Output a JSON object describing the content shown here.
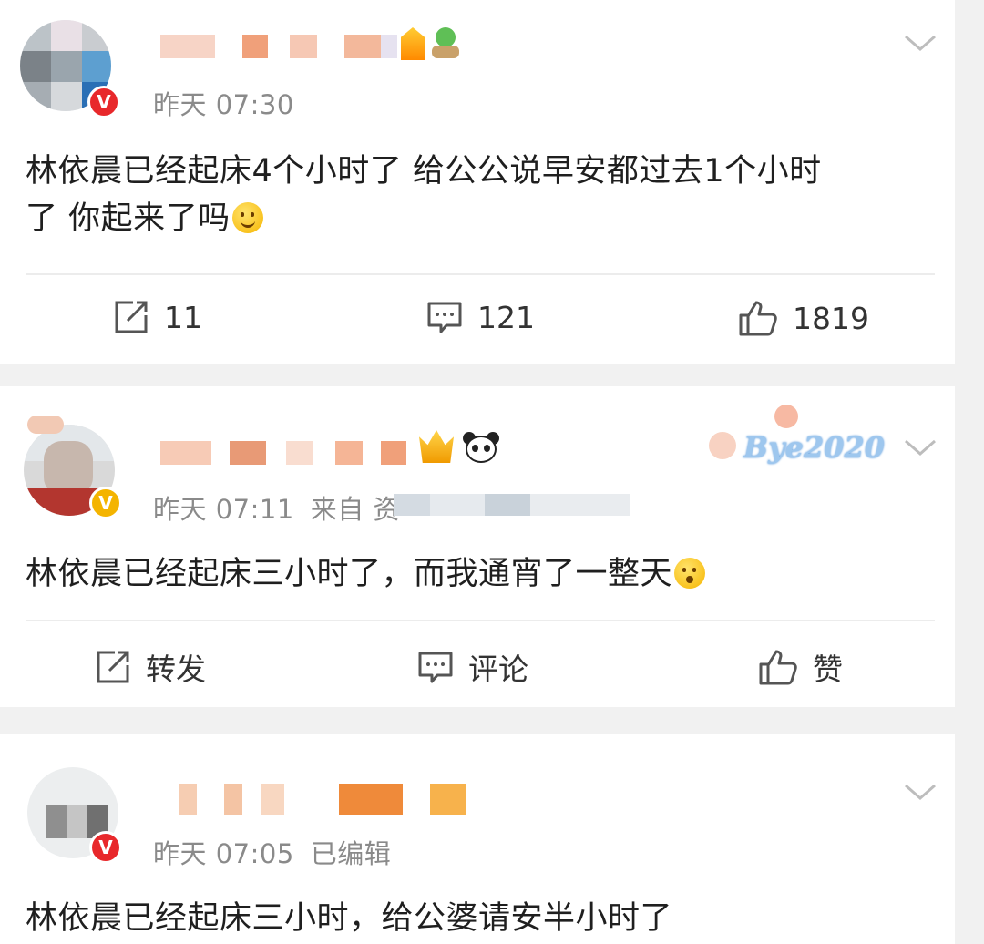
{
  "posts": [
    {
      "time": "昨天 07:30",
      "source": "",
      "text_line1": "林依晨已经起床4个小时了 给公公说早安都过去1个小时",
      "text_line2": "了 你起来了吗",
      "emoji": "smile-emoji",
      "repost_label": "11",
      "comment_label": "121",
      "like_label": "1819"
    },
    {
      "time": "昨天 07:11",
      "source": "来自 资",
      "text": "林依晨已经起床三小时了，而我通宵了一整天",
      "emoji": "shocked-emoji",
      "card_decoration": "Bye2020",
      "repost_label": "转发",
      "comment_label": "评论",
      "like_label": "赞"
    },
    {
      "time": "昨天 07:05",
      "edited": "已编辑",
      "text": "林依晨已经起床三小时，给公婆请安半小时了"
    }
  ],
  "colors": {
    "background": "#f1f1f1",
    "card": "#ffffff",
    "meta_text": "#8a8a8a",
    "verified_red": "#e8282b",
    "verified_gold": "#f4b400"
  }
}
